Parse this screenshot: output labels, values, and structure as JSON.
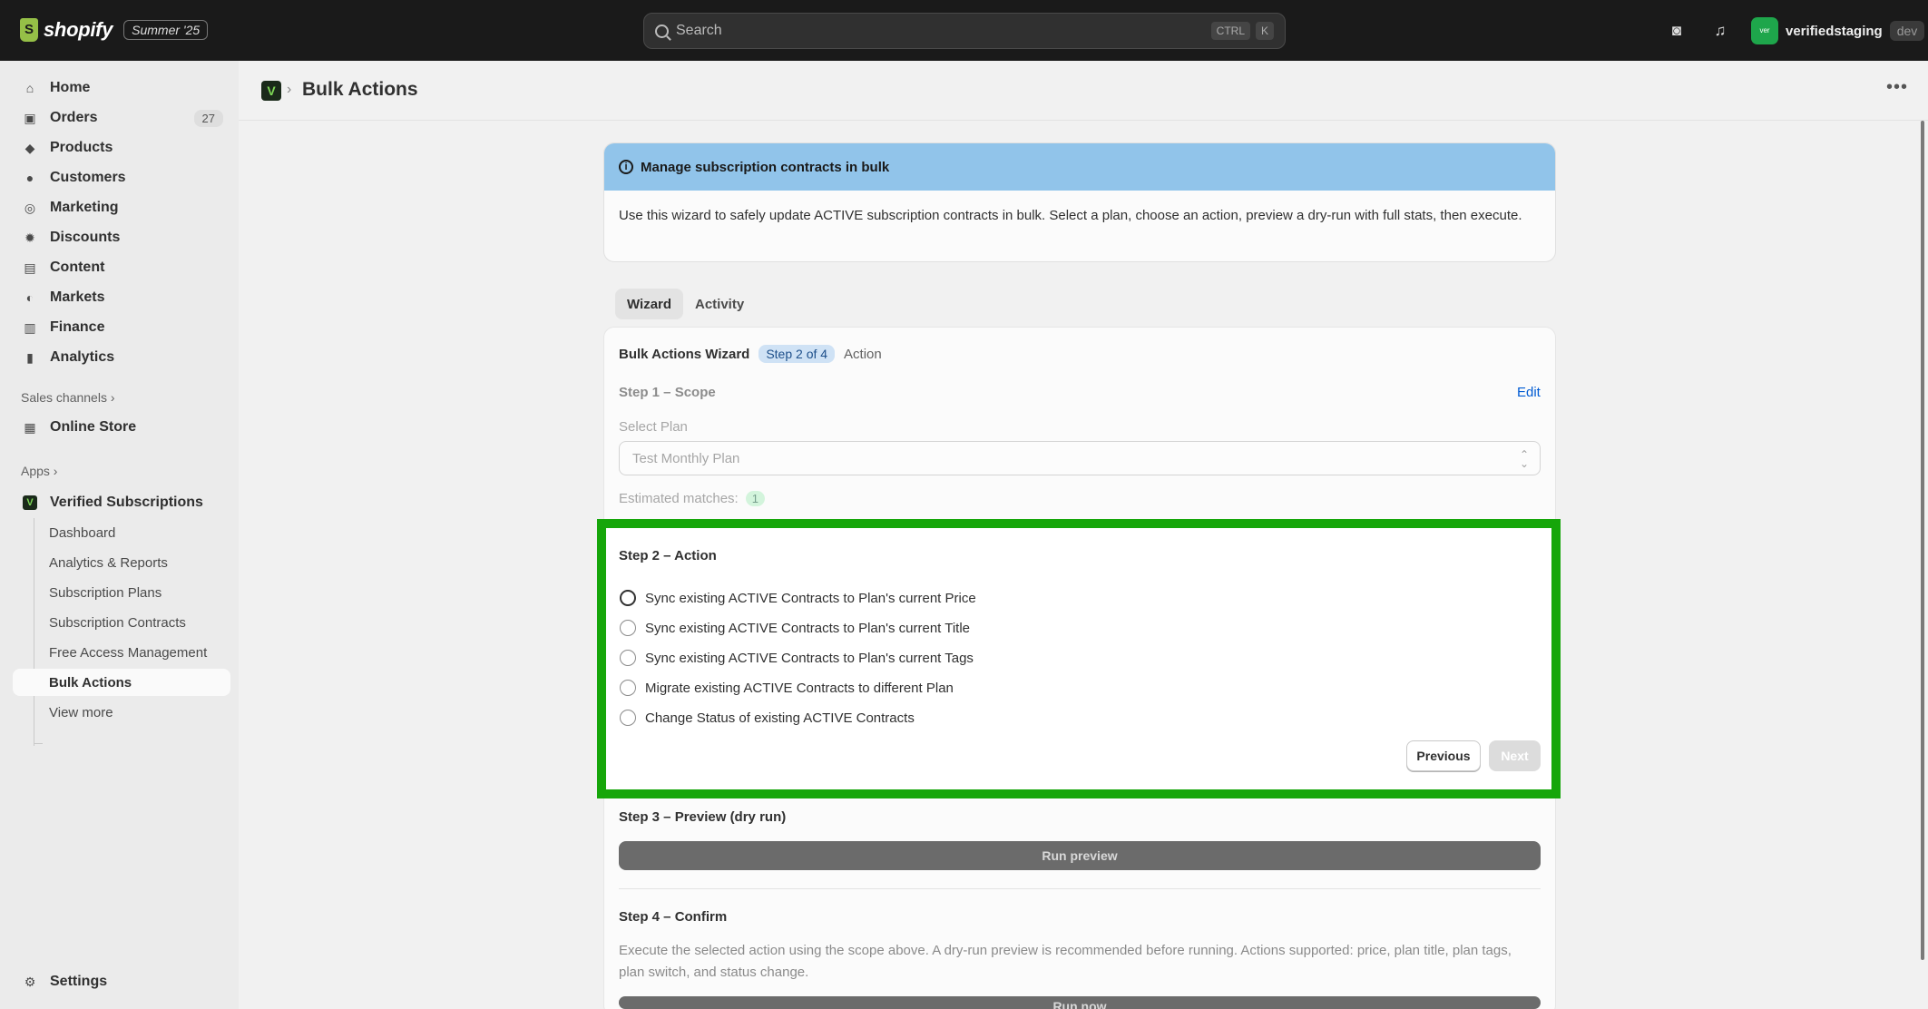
{
  "topbar": {
    "logo_text": "shopify",
    "edition_badge": "Summer '25",
    "search_placeholder": "Search",
    "shortcut_ctrl": "CTRL",
    "shortcut_k": "K",
    "store_avatar": "ver",
    "store_name": "verifiedstaging",
    "store_badge": "dev"
  },
  "sidebar": {
    "items": [
      {
        "label": "Home",
        "icon": "home-icon"
      },
      {
        "label": "Orders",
        "icon": "inbox-icon",
        "count": "27"
      },
      {
        "label": "Products",
        "icon": "tag-icon"
      },
      {
        "label": "Customers",
        "icon": "person-icon"
      },
      {
        "label": "Marketing",
        "icon": "target-icon"
      },
      {
        "label": "Discounts",
        "icon": "discount-icon"
      },
      {
        "label": "Content",
        "icon": "content-icon"
      },
      {
        "label": "Markets",
        "icon": "globe-icon"
      },
      {
        "label": "Finance",
        "icon": "bank-icon"
      },
      {
        "label": "Analytics",
        "icon": "chart-icon"
      }
    ],
    "sales_channels_label": "Sales channels",
    "online_store": "Online Store",
    "apps_label": "Apps",
    "app_name": "Verified Subscriptions",
    "app_sub_items": [
      "Dashboard",
      "Analytics & Reports",
      "Subscription Plans",
      "Subscription Contracts",
      "Free Access Management",
      "Bulk Actions",
      "View more"
    ],
    "settings": "Settings"
  },
  "page": {
    "title": "Bulk Actions"
  },
  "banner": {
    "title": "Manage subscription contracts in bulk",
    "body": "Use this wizard to safely update ACTIVE subscription contracts in bulk. Select a plan, choose an action, preview a dry-run with full stats, then execute."
  },
  "tabs": [
    "Wizard",
    "Activity"
  ],
  "wizard": {
    "title": "Bulk Actions Wizard",
    "step_badge": "Step 2 of 4",
    "step_name": "Action",
    "step1": {
      "heading": "Step 1 – Scope",
      "edit": "Edit",
      "select_label": "Select Plan",
      "select_value": "Test Monthly Plan",
      "matches_label": "Estimated matches:",
      "matches_count": "1"
    },
    "step2": {
      "heading": "Step 2 – Action",
      "options": [
        "Sync existing ACTIVE Contracts to Plan's current Price",
        "Sync existing ACTIVE Contracts to Plan's current Title",
        "Sync existing ACTIVE Contracts to Plan's current Tags",
        "Migrate existing ACTIVE Contracts to different Plan",
        "Change Status of existing ACTIVE Contracts"
      ],
      "previous": "Previous",
      "next": "Next"
    },
    "step3": {
      "heading": "Step 3 – Preview (dry run)",
      "button": "Run preview"
    },
    "step4": {
      "heading": "Step 4 – Confirm",
      "text": "Execute the selected action using the scope above. A dry-run preview is recommended before running. Actions supported: price, plan title, plan tags, plan switch, and status change.",
      "button": "Run now"
    }
  },
  "colors": {
    "highlight": "#16a60a",
    "banner": "#91c4ea",
    "topbar": "#1a1a1a"
  }
}
